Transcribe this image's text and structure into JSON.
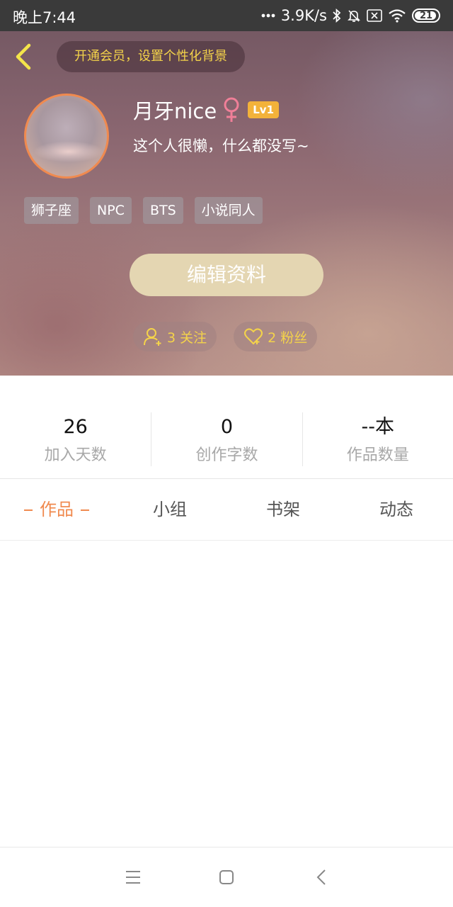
{
  "status_bar": {
    "time": "晚上7:44",
    "network_speed": "3.9K/s",
    "battery": "21",
    "icons": [
      "dots-icon",
      "bluetooth-icon",
      "mute-icon",
      "sim-icon",
      "wifi-icon",
      "battery-icon"
    ]
  },
  "header": {
    "vip_banner": "开通会员，设置个性化背景",
    "username": "月牙nice",
    "gender_symbol": "♀",
    "level": "Lv1",
    "bio": "这个人很懒，什么都没写~",
    "tags": [
      "狮子座",
      "NPC",
      "BTS",
      "小说同人"
    ],
    "edit_button": "编辑资料",
    "following": "3 关注",
    "followers": "2 粉丝"
  },
  "stats": [
    {
      "value": "26",
      "label": "加入天数"
    },
    {
      "value": "0",
      "label": "创作字数"
    },
    {
      "value": "--本",
      "label": "作品数量"
    }
  ],
  "tabs": [
    {
      "label": "作品",
      "active": true
    },
    {
      "label": "小组",
      "active": false
    },
    {
      "label": "书架",
      "active": false
    },
    {
      "label": "动态",
      "active": false
    }
  ],
  "colors": {
    "accent_orange": "#f08a4f",
    "vip_yellow": "#f4d34a",
    "level_badge": "#f3b23a",
    "edit_button_bg": "#e4d6b2",
    "gender_pink": "#f07f98"
  }
}
